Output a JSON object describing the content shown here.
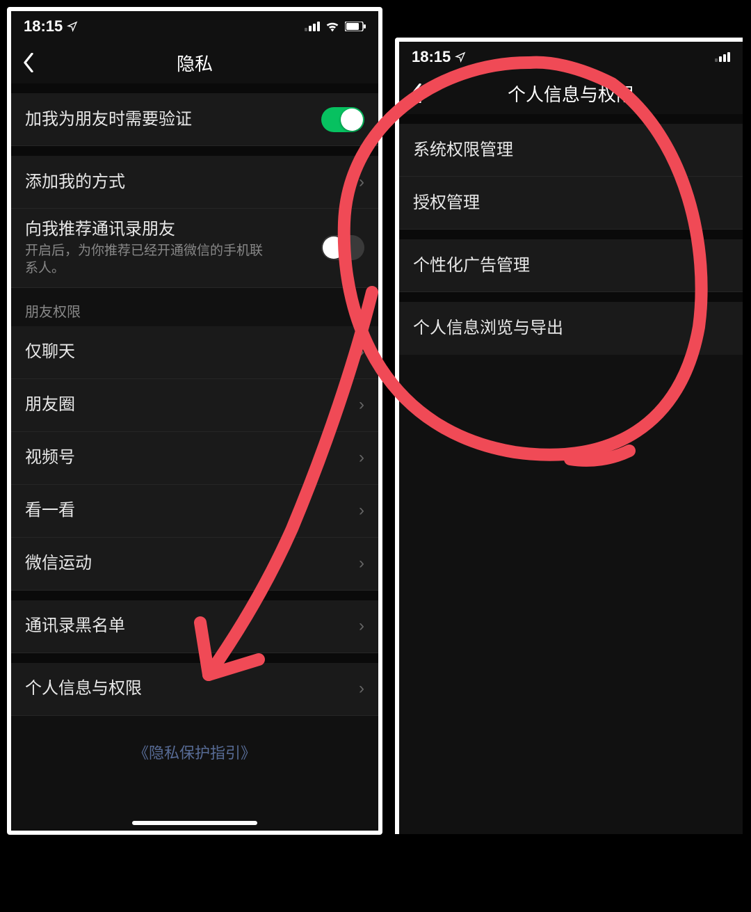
{
  "statusbar": {
    "time": "18:15"
  },
  "left": {
    "title": "隐私",
    "rows": {
      "verify": {
        "label": "加我为朋友时需要验证",
        "on": true
      },
      "addways": {
        "label": "添加我的方式"
      },
      "recommend": {
        "label": "向我推荐通讯录朋友",
        "sub": "开启后，为你推荐已经开通微信的手机联系人。",
        "on": false
      }
    },
    "section_friends_header": "朋友权限",
    "friends": [
      {
        "label": "仅聊天"
      },
      {
        "label": "朋友圈"
      },
      {
        "label": "视频号"
      },
      {
        "label": "看一看"
      },
      {
        "label": "微信运动"
      }
    ],
    "blacklist": {
      "label": "通讯录黑名单"
    },
    "personal": {
      "label": "个人信息与权限"
    },
    "footer_link": "《隐私保护指引》"
  },
  "right": {
    "title": "个人信息与权限",
    "items": [
      {
        "label": "系统权限管理"
      },
      {
        "label": "授权管理"
      },
      {
        "label": "个性化广告管理"
      },
      {
        "label": "个人信息浏览与导出"
      }
    ]
  },
  "colors": {
    "accent": "#07c160",
    "link": "#576b95",
    "annotation": "#f04a56"
  }
}
